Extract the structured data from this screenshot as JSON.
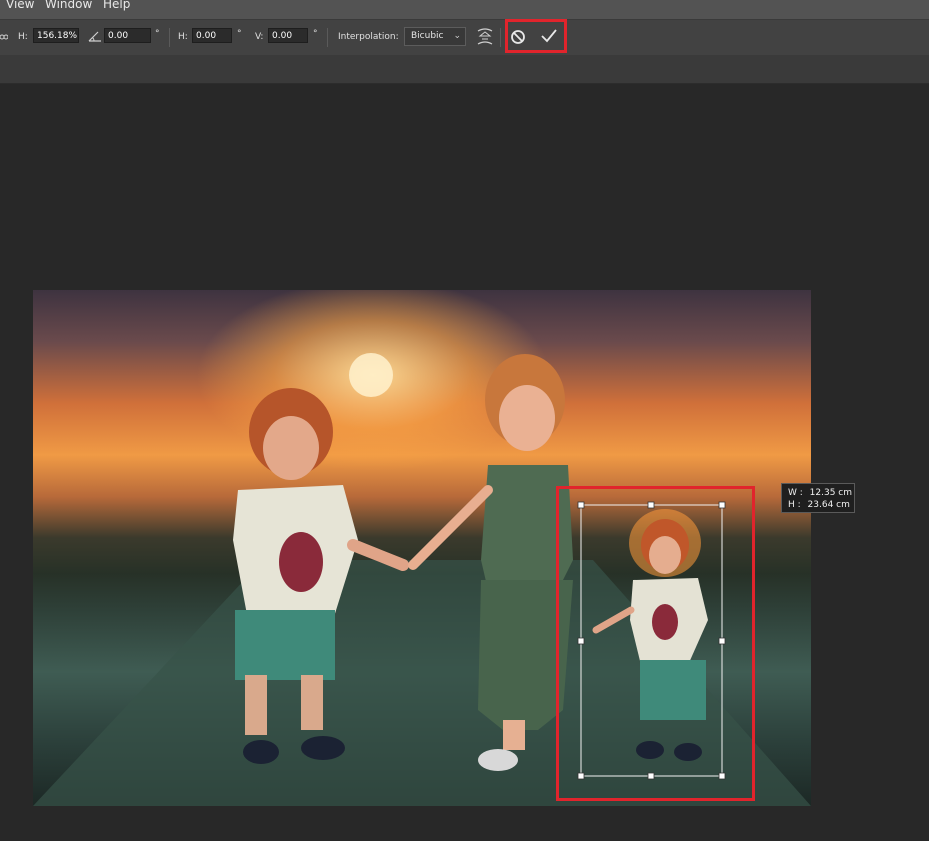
{
  "menu": {
    "items": [
      "View",
      "Window",
      "Help"
    ]
  },
  "options": {
    "h_scale_label": "H:",
    "h_scale_value": "156.18%",
    "angle_value": "0.00",
    "deg_symbol": "°",
    "skew_h_label": "H:",
    "skew_h_value": "0.00",
    "skew_v_label": "V:",
    "skew_v_value": "0.00",
    "interpolation_label": "Interpolation:",
    "interpolation_value": "Bicubic"
  },
  "tooltip": {
    "w_label": "W :",
    "w_value": "12.35 cm",
    "h_label": "H :",
    "h_value": "23.64 cm"
  },
  "colors": {
    "highlight": "#e1242c",
    "menubar": "#535353",
    "optionsbar": "#424242",
    "canvas": "#282828"
  },
  "icons": {
    "link": "link-icon",
    "angle": "angle-icon",
    "warp": "warp-icon",
    "cancel": "cancel-icon",
    "commit": "checkmark-icon",
    "dropdown": "chevron-down-icon"
  }
}
